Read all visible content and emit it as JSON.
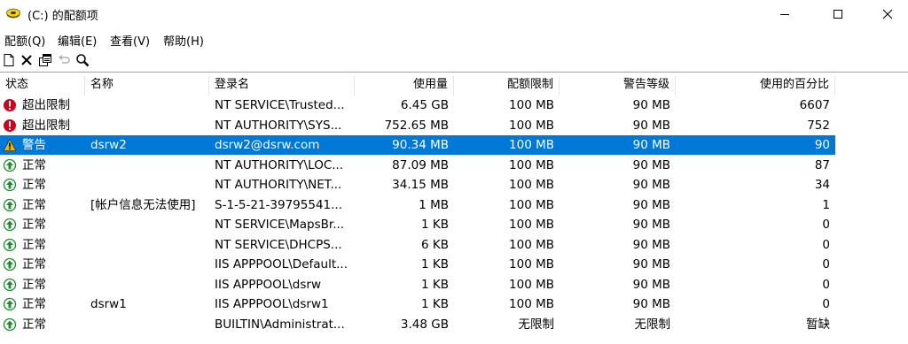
{
  "window": {
    "title": "(C:) 的配额项"
  },
  "menu": [
    {
      "label": "配额(Q)"
    },
    {
      "label": "编辑(E)"
    },
    {
      "label": "查看(V)"
    },
    {
      "label": "帮助(H)"
    }
  ],
  "toolbar": [
    {
      "icon": "new-entry-icon"
    },
    {
      "icon": "delete-icon"
    },
    {
      "icon": "properties-icon"
    },
    {
      "icon": "undo-icon"
    },
    {
      "icon": "find-icon"
    }
  ],
  "columns": [
    "状态",
    "名称",
    "登录名",
    "使用量",
    "配额限制",
    "警告等级",
    "使用的百分比"
  ],
  "rows": [
    {
      "status": "error",
      "status_label": "超出限制",
      "name": "",
      "login": "NT SERVICE\\Trusted...",
      "used": "6.45 GB",
      "limit": "100 MB",
      "warning": "90 MB",
      "percent": "6607",
      "selected": false
    },
    {
      "status": "error",
      "status_label": "超出限制",
      "name": "",
      "login": "NT AUTHORITY\\SYS...",
      "used": "752.65 MB",
      "limit": "100 MB",
      "warning": "90 MB",
      "percent": "752",
      "selected": false
    },
    {
      "status": "warning",
      "status_label": "警告",
      "name": "dsrw2",
      "login": "dsrw2@dsrw.com",
      "used": "90.34 MB",
      "limit": "100 MB",
      "warning": "90 MB",
      "percent": "90",
      "selected": true
    },
    {
      "status": "ok",
      "status_label": "正常",
      "name": "",
      "login": "NT AUTHORITY\\LOC...",
      "used": "87.09 MB",
      "limit": "100 MB",
      "warning": "90 MB",
      "percent": "87",
      "selected": false
    },
    {
      "status": "ok",
      "status_label": "正常",
      "name": "",
      "login": "NT AUTHORITY\\NET...",
      "used": "34.15 MB",
      "limit": "100 MB",
      "warning": "90 MB",
      "percent": "34",
      "selected": false
    },
    {
      "status": "ok",
      "status_label": "正常",
      "name": "[帐户信息无法使用]",
      "login": "S-1-5-21-39795541...",
      "used": "1 MB",
      "limit": "100 MB",
      "warning": "90 MB",
      "percent": "1",
      "selected": false
    },
    {
      "status": "ok",
      "status_label": "正常",
      "name": "",
      "login": "NT SERVICE\\MapsBr...",
      "used": "1 KB",
      "limit": "100 MB",
      "warning": "90 MB",
      "percent": "0",
      "selected": false
    },
    {
      "status": "ok",
      "status_label": "正常",
      "name": "",
      "login": "NT SERVICE\\DHCPS...",
      "used": "6 KB",
      "limit": "100 MB",
      "warning": "90 MB",
      "percent": "0",
      "selected": false
    },
    {
      "status": "ok",
      "status_label": "正常",
      "name": "",
      "login": "IIS APPPOOL\\Default...",
      "used": "1 KB",
      "limit": "100 MB",
      "warning": "90 MB",
      "percent": "0",
      "selected": false
    },
    {
      "status": "ok",
      "status_label": "正常",
      "name": "",
      "login": "IIS APPPOOL\\dsrw",
      "used": "1 KB",
      "limit": "100 MB",
      "warning": "90 MB",
      "percent": "0",
      "selected": false
    },
    {
      "status": "ok",
      "status_label": "正常",
      "name": "dsrw1",
      "login": "IIS APPPOOL\\dsrw1",
      "used": "1 KB",
      "limit": "100 MB",
      "warning": "90 MB",
      "percent": "0",
      "selected": false
    },
    {
      "status": "ok",
      "status_label": "正常",
      "name": "",
      "login": "BUILTIN\\Administrat...",
      "used": "3.48 GB",
      "limit": "无限制",
      "warning": "无限制",
      "percent": "暂缺",
      "selected": false
    }
  ],
  "colors": {
    "selection": "#0078d7",
    "error": "#d0021b",
    "warning": "#e8b800",
    "ok": "#1e8a2e"
  }
}
